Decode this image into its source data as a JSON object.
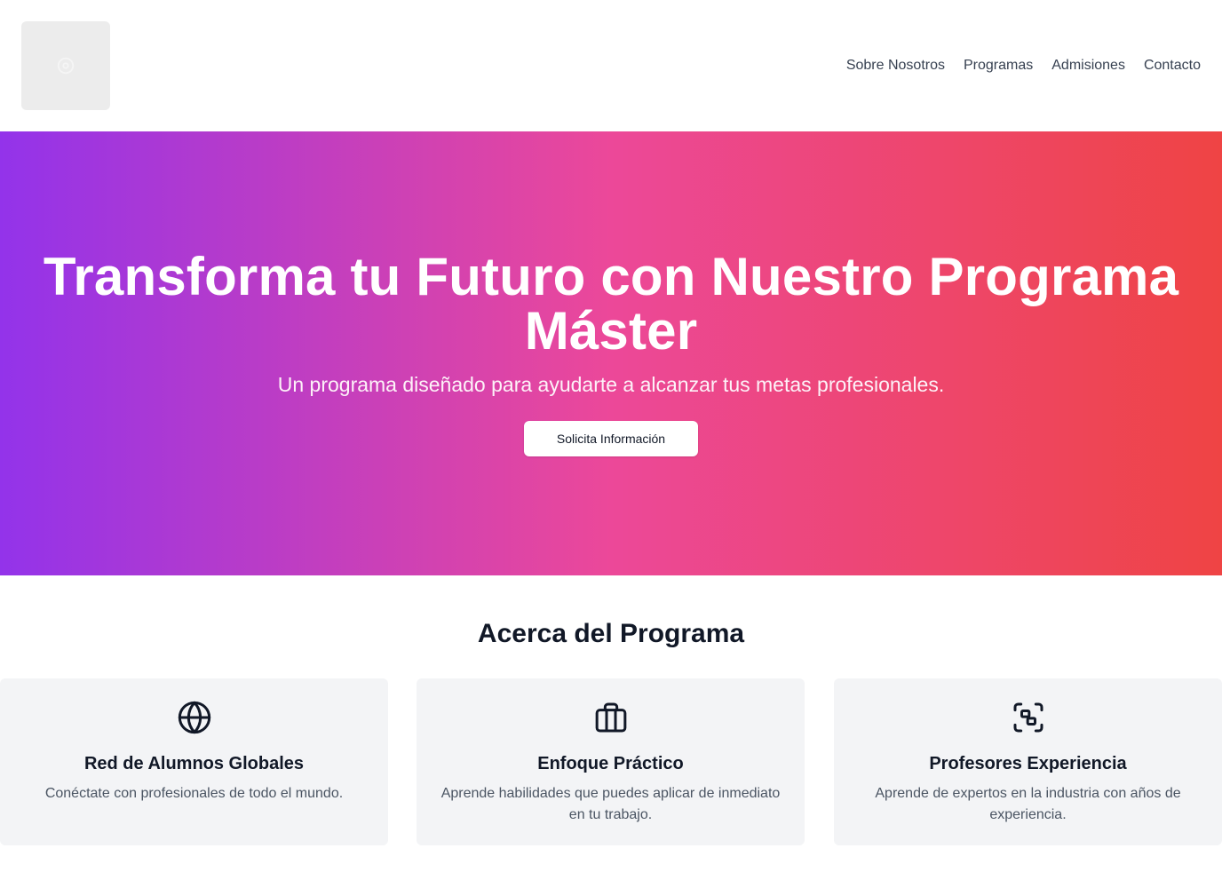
{
  "header": {
    "logo_icon": "image-placeholder-icon",
    "nav": [
      {
        "label": "Sobre Nosotros"
      },
      {
        "label": "Programas"
      },
      {
        "label": "Admisiones"
      },
      {
        "label": "Contacto"
      }
    ]
  },
  "hero": {
    "title": "Transforma tu Futuro con Nuestro Programa Máster",
    "subtitle": "Un programa diseñado para ayudarte a alcanzar tus metas profesionales.",
    "cta_label": "Solicita Información",
    "gradient_colors": [
      "#9333ea",
      "#ec4899",
      "#ef4444"
    ]
  },
  "about": {
    "title": "Acerca del Programa",
    "cards": [
      {
        "icon": "globe-icon",
        "title": "Red de Alumnos Globales",
        "text": "Conéctate con profesionales de todo el mundo."
      },
      {
        "icon": "briefcase-icon",
        "title": "Enfoque Práctico",
        "text": "Aprende habilidades que puedes aplicar de inmediato en tu trabajo."
      },
      {
        "icon": "scan-icon",
        "title": "Profesores Experiencia",
        "text": "Aprende de expertos en la industria con años de experiencia."
      }
    ]
  }
}
